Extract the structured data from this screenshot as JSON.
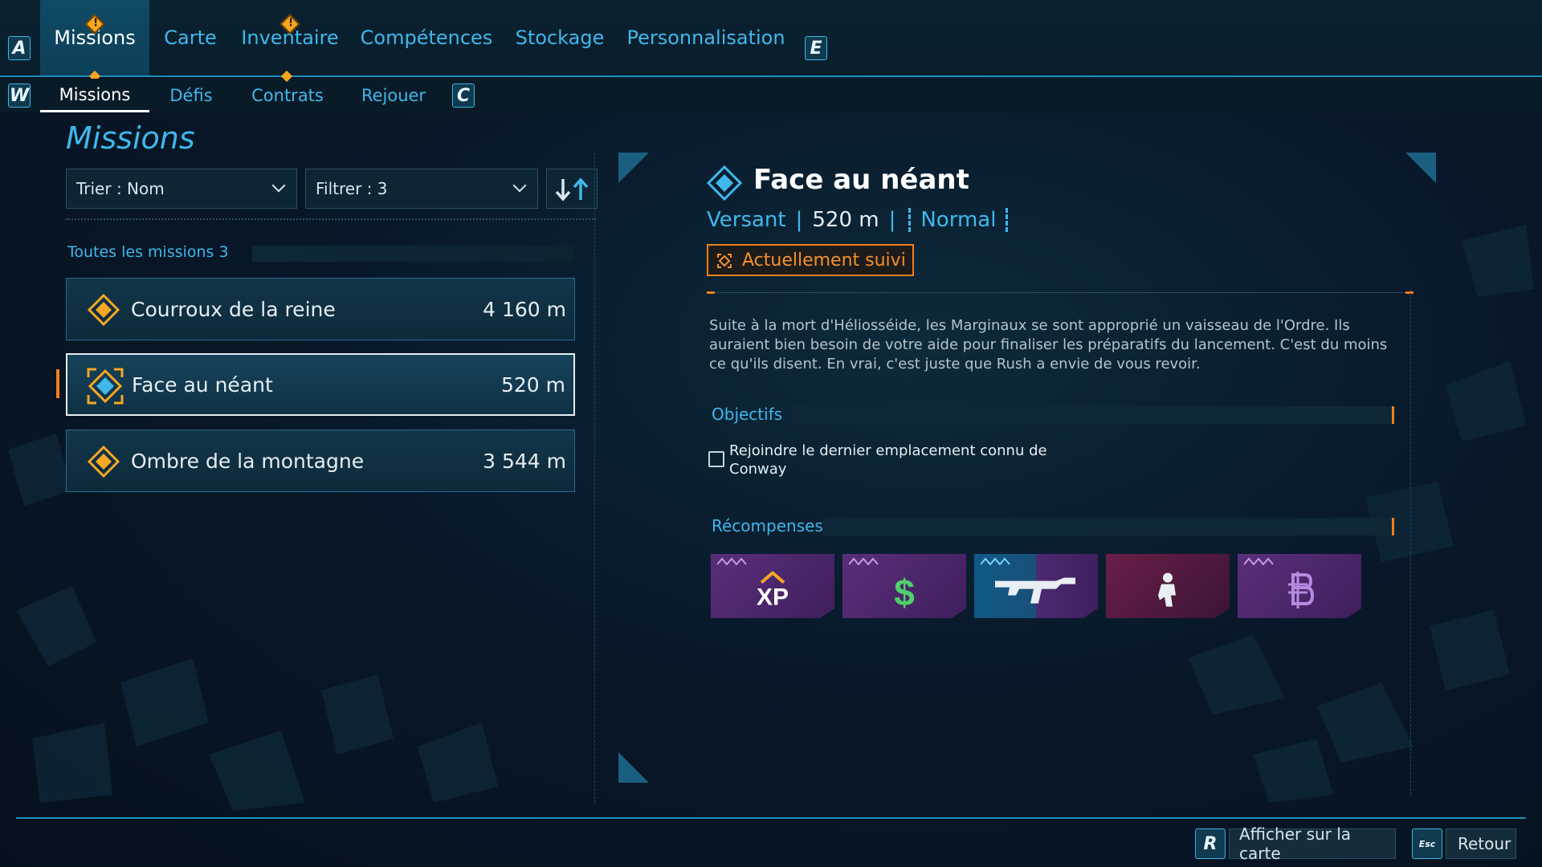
{
  "top_nav": {
    "left_key": "A",
    "right_key": "E",
    "tabs": [
      {
        "label": "Missions",
        "active": true,
        "alert": true
      },
      {
        "label": "Carte",
        "active": false,
        "alert": false
      },
      {
        "label": "Inventaire",
        "active": false,
        "alert": true
      },
      {
        "label": "Compétences",
        "active": false,
        "alert": false
      },
      {
        "label": "Stockage",
        "active": false,
        "alert": false
      },
      {
        "label": "Personnalisation",
        "active": false,
        "alert": false
      }
    ]
  },
  "sub_nav": {
    "left_key": "W",
    "right_key": "C",
    "tabs": [
      {
        "label": "Missions",
        "active": true
      },
      {
        "label": "Défis",
        "active": false
      },
      {
        "label": "Contrats",
        "active": false
      },
      {
        "label": "Rejouer",
        "active": false
      }
    ]
  },
  "left_panel": {
    "title": "Missions",
    "sort_dropdown": "Trier : Nom",
    "filter_dropdown": "Filtrer : 3",
    "group_label": "Toutes les missions 3",
    "missions": [
      {
        "name": "Courroux de la reine",
        "distance": "4 160 m",
        "selected": false
      },
      {
        "name": "Face au néant",
        "distance": "520 m",
        "selected": true
      },
      {
        "name": "Ombre de la montagne",
        "distance": "3 544 m",
        "selected": false
      }
    ]
  },
  "detail": {
    "title": "Face au néant",
    "region": "Versant",
    "distance": "520 m",
    "difficulty": "Normal",
    "tracked_label": "Actuellement suivi",
    "description": "Suite à la mort d'Héliosséide, les Marginaux se sont approprié un vaisseau de l'Ordre. Ils auraient bien besoin de votre aide pour finaliser les préparatifs du lancement. C'est du moins ce qu'ils disent. En vrai, c'est juste que Rush a envie de vous revoir.",
    "objectives_label": "Objectifs",
    "objectives": [
      {
        "text": "Rejoindre le dernier emplacement connu de Conway",
        "done": false
      }
    ],
    "rewards_label": "Récompenses",
    "rewards": [
      {
        "icon": "xp-icon",
        "kind": "XP"
      },
      {
        "icon": "money-icon",
        "kind": "$"
      },
      {
        "icon": "weapon-icon",
        "kind": "weapon"
      },
      {
        "icon": "character-icon",
        "kind": "cosmetic"
      },
      {
        "icon": "eridium-icon",
        "kind": "currency"
      }
    ]
  },
  "footer": {
    "map_key": "R",
    "map_label": "Afficher sur la carte",
    "back_key": "Esc",
    "back_label": "Retour"
  },
  "colors": {
    "accent_blue": "#3fb8ec",
    "accent_orange": "#f07f1a",
    "alert_yellow": "#f5a623",
    "reward_purple": "#5a2e7a"
  }
}
